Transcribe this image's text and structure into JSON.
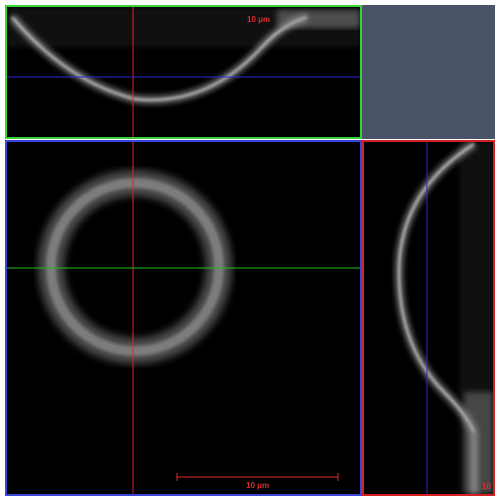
{
  "views": {
    "xz": {
      "scale_bar_label": "10 μm"
    },
    "xy": {
      "scale_bar_label": "10 μm"
    },
    "yz": {
      "scale_bar_label": "10"
    }
  },
  "colors": {
    "xz_border": "#3bd13b",
    "xy_border": "#3b46d8",
    "yz_border": "#d42020",
    "corner_panel": "#4a5469",
    "crosshair_red": "#e02020",
    "crosshair_green": "#22c022",
    "crosshair_blue": "#2a2ad8",
    "scale_bar": "#e02b2b"
  }
}
